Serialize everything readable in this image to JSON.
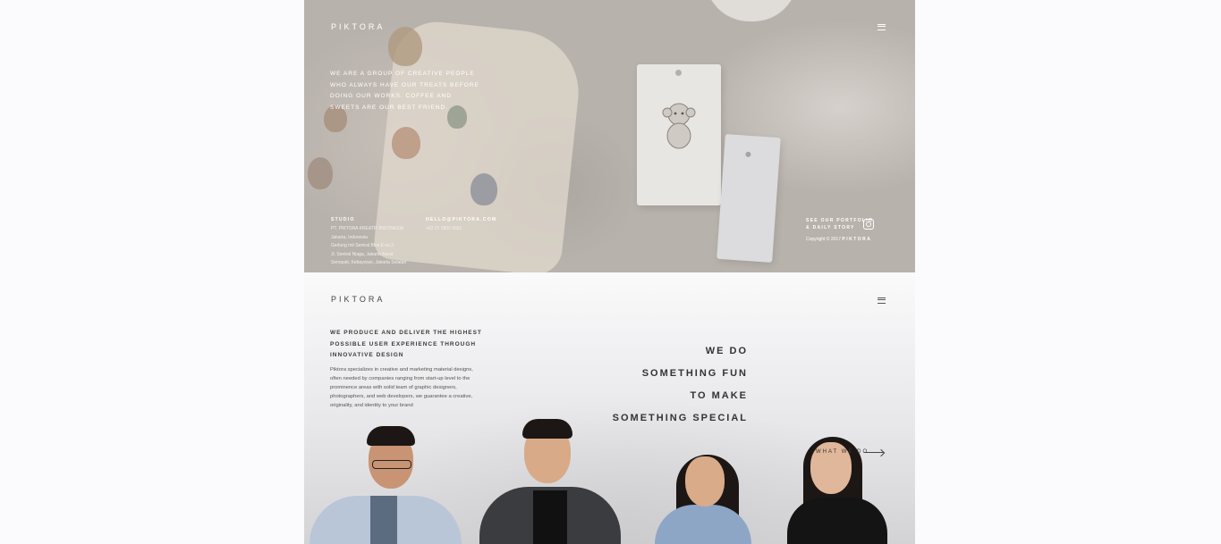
{
  "brand": {
    "logo": "PIKTORA"
  },
  "hero": {
    "intro": "We are a group of creative people who always have our treats before doing our works. Coffee and sweets are our best friend."
  },
  "footer": {
    "studio": {
      "title": "STUDIO",
      "lines": [
        "PT. PIKTORA KREATIF INDONESIA",
        "Jakarta, Indonesia",
        "Gedung Inti Sentral Blok E no.2",
        "Jl. Sentral Niaga, Jakarta Barat",
        "Senopati, Kebayoran, Jakarta Selatan"
      ]
    },
    "contact": {
      "email": "HELLO@PIKTORA.COM",
      "phone": "+62 21 2900 6581"
    },
    "social": {
      "line1": "SEE OUR PORTFOLIO",
      "line2": "& DAILY STORY"
    },
    "copyright_prefix": "Copyright",
    "copyright_brand": "PIKTORA"
  },
  "about": {
    "tagline": "WE PRODUCE AND DELIVER THE HIGHEST POSSIBLE USER EXPERIENCE THROUGH INNOVATIVE DESIGN",
    "description": "Piktora specializes in creative and marketing material designs, often needed by companies ranging from start-up level to the prominence areas with solid team of graphic designers, photographers, and web developers, we guarantee a creative, originality, and identity to your brand",
    "headline": [
      "WE DO",
      "SOMETHING FUN",
      "TO MAKE",
      "SOMETHING SPECIAL"
    ],
    "cta": "WHAT WE DO"
  },
  "colors": {
    "hero_bg": "#b8b2ac",
    "about_bg": "#f7f7f8",
    "text_dark": "#333333",
    "text_light": "#ffffff"
  },
  "icons": {
    "menu": "hamburger-menu-icon",
    "social": "instagram-icon",
    "cta": "arrow-right-icon"
  }
}
